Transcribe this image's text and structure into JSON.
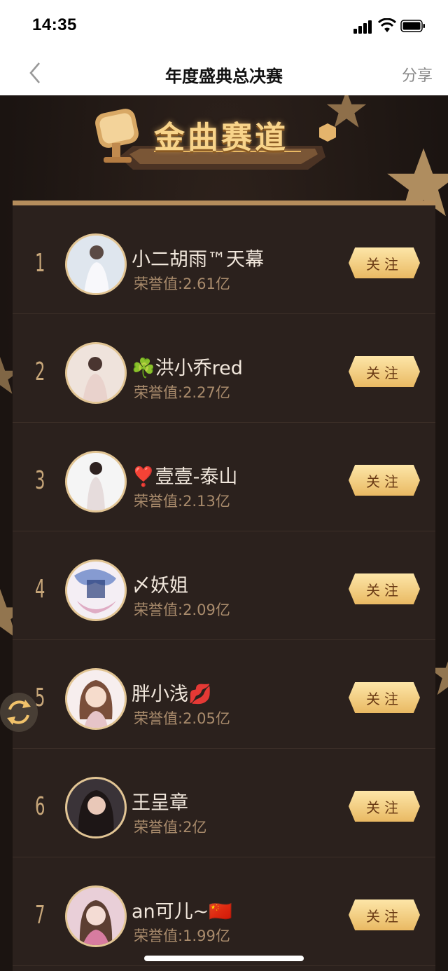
{
  "status_bar": {
    "time": "14:35"
  },
  "navbar": {
    "title": "年度盛典总决赛",
    "share_label": "分享"
  },
  "banner": {
    "title": "金曲赛道"
  },
  "ranking": [
    {
      "rank": "1",
      "name": "小二胡雨™天幕",
      "honor": "荣誉值:2.61亿",
      "follow_label": "关注"
    },
    {
      "rank": "2",
      "name": "☘️洪小乔red",
      "honor": "荣誉值:2.27亿",
      "follow_label": "关注"
    },
    {
      "rank": "3",
      "name": "❣️壹壹-泰山",
      "honor": "荣誉值:2.13亿",
      "follow_label": "关注"
    },
    {
      "rank": "4",
      "name": "〆妖姐",
      "honor": "荣誉值:2.09亿",
      "follow_label": "关注"
    },
    {
      "rank": "5",
      "name": "胖小浅💋",
      "honor": "荣誉值:2.05亿",
      "follow_label": "关注"
    },
    {
      "rank": "6",
      "name": "王呈章",
      "honor": "荣誉值:2亿",
      "follow_label": "关注"
    },
    {
      "rank": "7",
      "name": "an可儿~🇨🇳",
      "honor": "荣誉值:1.99亿",
      "follow_label": "关注"
    }
  ],
  "colors": {
    "gold": "#e9b963",
    "panel": "#2b211d",
    "background": "#1c1513"
  }
}
